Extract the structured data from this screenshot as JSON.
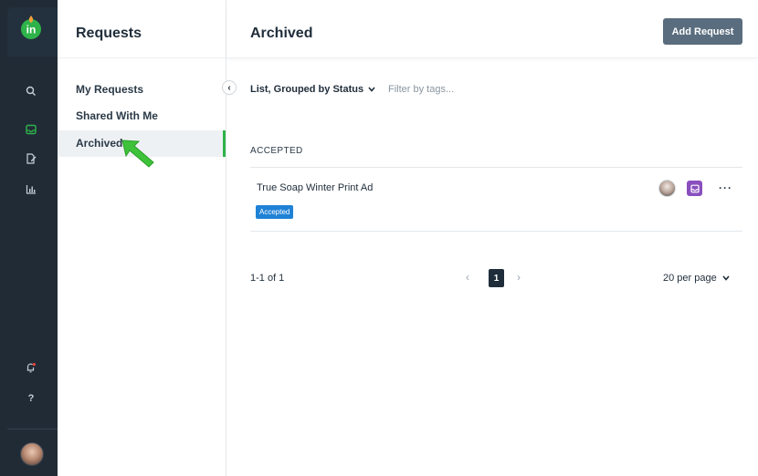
{
  "rail": {
    "logo_text": "in",
    "icons": [
      "search-icon",
      "inbox-icon",
      "edit-document-icon",
      "reports-chart-icon",
      "notification-bell-icon",
      "help-icon"
    ],
    "help_text": "?",
    "active_color": "#2eb34a",
    "bg_color": "#212b36"
  },
  "nav": {
    "title": "Requests",
    "items": [
      {
        "label": "My Requests",
        "active": false
      },
      {
        "label": "Shared With Me",
        "active": false
      },
      {
        "label": "Archived",
        "active": true
      }
    ],
    "collapse_glyph": "‹"
  },
  "main": {
    "title": "Archived",
    "add_button_label": "Add Request",
    "view_select_label": "List, Grouped by Status",
    "filter_placeholder": "Filter by tags...",
    "groups": [
      {
        "label": "ACCEPTED",
        "rows": [
          {
            "title": "True Soap Winter Print Ad",
            "status_badge": "Accepted",
            "more_glyph": "···"
          }
        ]
      }
    ],
    "pagination": {
      "range_text": "1-1 of 1",
      "prev_glyph": "‹",
      "current_page": "1",
      "next_glyph": "›",
      "per_page_label": "20 per page"
    }
  },
  "colors": {
    "accent_green": "#2eb34a",
    "button_gray": "#5a6d7e",
    "badge_blue": "#1f82d6",
    "inbox_purple": "#8a4fbe",
    "pager_dark": "#1f2d3a"
  }
}
